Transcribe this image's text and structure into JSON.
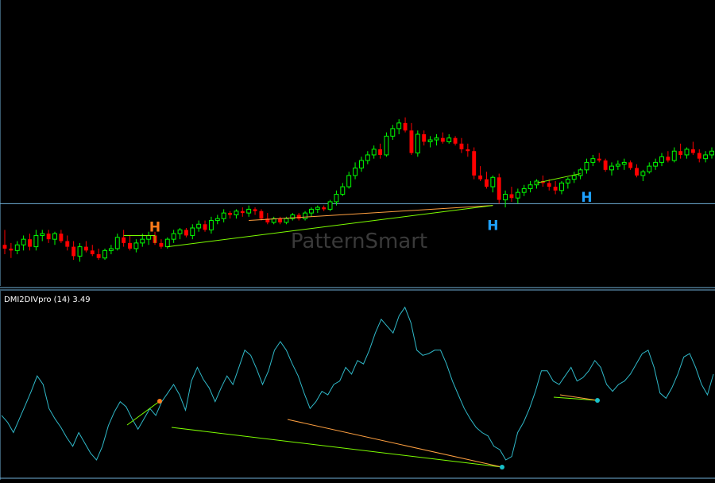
{
  "watermark": "PatternSmart",
  "indicator_label": "DMI2DIVpro (14) 3.49",
  "colors": {
    "background": "#000000",
    "bull_candle": "#00ff00",
    "bear_candle": "#ff0000",
    "indicator_line": "#2fb8c8",
    "border": "#6fb0d8",
    "level_line": "#6fb0d8",
    "div_green": "#7cfc00",
    "div_orange": "#ffa040",
    "marker_orange": "#ff7a1a",
    "marker_blue": "#1ea0ff",
    "marker_cyan": "#18c0c8",
    "watermark": "#3a3a3a"
  },
  "chart_data": [
    {
      "type": "candlestick",
      "price_range": [
        0,
        100
      ],
      "horizontal_level": 38,
      "candles": [
        {
          "o": 16,
          "h": 24,
          "l": 11,
          "c": 14
        },
        {
          "o": 14,
          "h": 17,
          "l": 9,
          "c": 13
        },
        {
          "o": 13,
          "h": 18,
          "l": 11,
          "c": 16
        },
        {
          "o": 16,
          "h": 21,
          "l": 13,
          "c": 19
        },
        {
          "o": 19,
          "h": 22,
          "l": 13,
          "c": 15
        },
        {
          "o": 15,
          "h": 24,
          "l": 13,
          "c": 21
        },
        {
          "o": 21,
          "h": 24,
          "l": 18,
          "c": 22
        },
        {
          "o": 22,
          "h": 24,
          "l": 17,
          "c": 19
        },
        {
          "o": 19,
          "h": 23,
          "l": 16,
          "c": 22
        },
        {
          "o": 22,
          "h": 24,
          "l": 17,
          "c": 18
        },
        {
          "o": 18,
          "h": 21,
          "l": 13,
          "c": 15
        },
        {
          "o": 15,
          "h": 18,
          "l": 8,
          "c": 10
        },
        {
          "o": 10,
          "h": 17,
          "l": 7,
          "c": 15
        },
        {
          "o": 15,
          "h": 18,
          "l": 12,
          "c": 13
        },
        {
          "o": 13,
          "h": 16,
          "l": 10,
          "c": 11
        },
        {
          "o": 11,
          "h": 14,
          "l": 8,
          "c": 9
        },
        {
          "o": 9,
          "h": 14,
          "l": 8,
          "c": 13
        },
        {
          "o": 13,
          "h": 16,
          "l": 11,
          "c": 14
        },
        {
          "o": 14,
          "h": 22,
          "l": 13,
          "c": 20
        },
        {
          "o": 20,
          "h": 24,
          "l": 15,
          "c": 17
        },
        {
          "o": 17,
          "h": 21,
          "l": 13,
          "c": 14
        },
        {
          "o": 14,
          "h": 19,
          "l": 12,
          "c": 17
        },
        {
          "o": 17,
          "h": 22,
          "l": 15,
          "c": 19
        },
        {
          "o": 19,
          "h": 23,
          "l": 16,
          "c": 21
        },
        {
          "o": 21,
          "h": 23,
          "l": 16,
          "c": 17
        },
        {
          "o": 17,
          "h": 19,
          "l": 14,
          "c": 15
        },
        {
          "o": 15,
          "h": 20,
          "l": 14,
          "c": 19
        },
        {
          "o": 19,
          "h": 24,
          "l": 17,
          "c": 22
        },
        {
          "o": 22,
          "h": 25,
          "l": 19,
          "c": 24
        },
        {
          "o": 24,
          "h": 25,
          "l": 20,
          "c": 21
        },
        {
          "o": 21,
          "h": 27,
          "l": 19,
          "c": 25
        },
        {
          "o": 25,
          "h": 29,
          "l": 23,
          "c": 27
        },
        {
          "o": 27,
          "h": 29,
          "l": 23,
          "c": 24
        },
        {
          "o": 24,
          "h": 31,
          "l": 22,
          "c": 29
        },
        {
          "o": 29,
          "h": 32,
          "l": 27,
          "c": 30
        },
        {
          "o": 30,
          "h": 35,
          "l": 28,
          "c": 33
        },
        {
          "o": 33,
          "h": 34,
          "l": 30,
          "c": 32
        },
        {
          "o": 32,
          "h": 35,
          "l": 30,
          "c": 34
        },
        {
          "o": 34,
          "h": 36,
          "l": 31,
          "c": 33
        },
        {
          "o": 33,
          "h": 37,
          "l": 31,
          "c": 35
        },
        {
          "o": 35,
          "h": 36,
          "l": 32,
          "c": 34
        },
        {
          "o": 34,
          "h": 35,
          "l": 29,
          "c": 30
        },
        {
          "o": 30,
          "h": 33,
          "l": 27,
          "c": 28
        },
        {
          "o": 28,
          "h": 31,
          "l": 27,
          "c": 30
        },
        {
          "o": 30,
          "h": 31,
          "l": 27,
          "c": 28
        },
        {
          "o": 28,
          "h": 31,
          "l": 27,
          "c": 30
        },
        {
          "o": 30,
          "h": 33,
          "l": 29,
          "c": 32
        },
        {
          "o": 32,
          "h": 33,
          "l": 29,
          "c": 30
        },
        {
          "o": 30,
          "h": 34,
          "l": 29,
          "c": 33
        },
        {
          "o": 33,
          "h": 36,
          "l": 31,
          "c": 35
        },
        {
          "o": 35,
          "h": 37,
          "l": 33,
          "c": 36
        },
        {
          "o": 36,
          "h": 37,
          "l": 34,
          "c": 35
        },
        {
          "o": 35,
          "h": 40,
          "l": 34,
          "c": 39
        },
        {
          "o": 39,
          "h": 45,
          "l": 37,
          "c": 43
        },
        {
          "o": 43,
          "h": 49,
          "l": 42,
          "c": 47
        },
        {
          "o": 47,
          "h": 55,
          "l": 46,
          "c": 53
        },
        {
          "o": 53,
          "h": 60,
          "l": 51,
          "c": 57
        },
        {
          "o": 57,
          "h": 63,
          "l": 55,
          "c": 61
        },
        {
          "o": 61,
          "h": 66,
          "l": 59,
          "c": 64
        },
        {
          "o": 64,
          "h": 69,
          "l": 62,
          "c": 67
        },
        {
          "o": 67,
          "h": 70,
          "l": 62,
          "c": 64
        },
        {
          "o": 64,
          "h": 76,
          "l": 63,
          "c": 74
        },
        {
          "o": 74,
          "h": 80,
          "l": 72,
          "c": 78
        },
        {
          "o": 78,
          "h": 83,
          "l": 75,
          "c": 81
        },
        {
          "o": 81,
          "h": 84,
          "l": 76,
          "c": 77
        },
        {
          "o": 77,
          "h": 81,
          "l": 64,
          "c": 65
        },
        {
          "o": 65,
          "h": 77,
          "l": 63,
          "c": 75
        },
        {
          "o": 75,
          "h": 77,
          "l": 69,
          "c": 71
        },
        {
          "o": 71,
          "h": 74,
          "l": 68,
          "c": 72
        },
        {
          "o": 72,
          "h": 75,
          "l": 69,
          "c": 73
        },
        {
          "o": 73,
          "h": 76,
          "l": 70,
          "c": 71
        },
        {
          "o": 71,
          "h": 75,
          "l": 70,
          "c": 73
        },
        {
          "o": 73,
          "h": 74,
          "l": 69,
          "c": 70
        },
        {
          "o": 70,
          "h": 73,
          "l": 65,
          "c": 67
        },
        {
          "o": 67,
          "h": 70,
          "l": 63,
          "c": 66
        },
        {
          "o": 66,
          "h": 68,
          "l": 51,
          "c": 53
        },
        {
          "o": 53,
          "h": 58,
          "l": 50,
          "c": 51
        },
        {
          "o": 51,
          "h": 55,
          "l": 46,
          "c": 47
        },
        {
          "o": 47,
          "h": 53,
          "l": 44,
          "c": 52
        },
        {
          "o": 52,
          "h": 54,
          "l": 38,
          "c": 40
        },
        {
          "o": 40,
          "h": 45,
          "l": 36,
          "c": 43
        },
        {
          "o": 43,
          "h": 47,
          "l": 39,
          "c": 41
        },
        {
          "o": 41,
          "h": 46,
          "l": 38,
          "c": 44
        },
        {
          "o": 44,
          "h": 48,
          "l": 42,
          "c": 46
        },
        {
          "o": 46,
          "h": 50,
          "l": 44,
          "c": 48
        },
        {
          "o": 48,
          "h": 51,
          "l": 46,
          "c": 50
        },
        {
          "o": 50,
          "h": 53,
          "l": 47,
          "c": 49
        },
        {
          "o": 49,
          "h": 51,
          "l": 45,
          "c": 47
        },
        {
          "o": 47,
          "h": 50,
          "l": 43,
          "c": 45
        },
        {
          "o": 45,
          "h": 50,
          "l": 43,
          "c": 49
        },
        {
          "o": 49,
          "h": 52,
          "l": 46,
          "c": 51
        },
        {
          "o": 51,
          "h": 55,
          "l": 49,
          "c": 53
        },
        {
          "o": 53,
          "h": 57,
          "l": 51,
          "c": 56
        },
        {
          "o": 56,
          "h": 62,
          "l": 54,
          "c": 60
        },
        {
          "o": 60,
          "h": 64,
          "l": 58,
          "c": 62
        },
        {
          "o": 62,
          "h": 65,
          "l": 60,
          "c": 61
        },
        {
          "o": 61,
          "h": 62,
          "l": 55,
          "c": 56
        },
        {
          "o": 56,
          "h": 60,
          "l": 53,
          "c": 58
        },
        {
          "o": 58,
          "h": 61,
          "l": 56,
          "c": 59
        },
        {
          "o": 59,
          "h": 62,
          "l": 56,
          "c": 60
        },
        {
          "o": 60,
          "h": 61,
          "l": 56,
          "c": 57
        },
        {
          "o": 57,
          "h": 59,
          "l": 52,
          "c": 53
        },
        {
          "o": 53,
          "h": 56,
          "l": 50,
          "c": 55
        },
        {
          "o": 55,
          "h": 60,
          "l": 54,
          "c": 58
        },
        {
          "o": 58,
          "h": 62,
          "l": 56,
          "c": 60
        },
        {
          "o": 60,
          "h": 65,
          "l": 58,
          "c": 63
        },
        {
          "o": 63,
          "h": 66,
          "l": 60,
          "c": 61
        },
        {
          "o": 61,
          "h": 68,
          "l": 60,
          "c": 66
        },
        {
          "o": 66,
          "h": 70,
          "l": 62,
          "c": 64
        },
        {
          "o": 64,
          "h": 68,
          "l": 62,
          "c": 67
        },
        {
          "o": 67,
          "h": 71,
          "l": 64,
          "c": 65
        },
        {
          "o": 65,
          "h": 67,
          "l": 60,
          "c": 62
        },
        {
          "o": 62,
          "h": 66,
          "l": 60,
          "c": 64
        },
        {
          "o": 64,
          "h": 68,
          "l": 62,
          "c": 66
        }
      ],
      "divergence_lines": [
        {
          "from": [
            39,
            29
          ],
          "to": [
            78,
            37
          ],
          "color": "div_orange"
        },
        {
          "from": [
            26,
            15
          ],
          "to": [
            78,
            37
          ],
          "color": "div_green"
        },
        {
          "from": [
            19,
            21
          ],
          "to": [
            24,
            21
          ],
          "color": "div_green"
        },
        {
          "from": [
            85,
            49
          ],
          "to": [
            92,
            54
          ],
          "color": "div_green"
        },
        {
          "from": [
            24,
            17
          ],
          "to": [
            24,
            21
          ],
          "color": "div_green"
        }
      ],
      "labels": [
        {
          "text": "H",
          "x": 24,
          "y": 23,
          "color": "marker_orange"
        },
        {
          "text": "H",
          "x": 78,
          "y": 24,
          "color": "marker_blue"
        },
        {
          "text": "H",
          "x": 93,
          "y": 39,
          "color": "marker_blue"
        }
      ]
    },
    {
      "type": "line",
      "name": "DMI2DIVpro (14) 3.49",
      "y_range": [
        0,
        100
      ],
      "values": [
        32,
        28,
        22,
        30,
        38,
        46,
        55,
        50,
        36,
        30,
        25,
        19,
        14,
        22,
        16,
        10,
        6,
        14,
        26,
        34,
        40,
        37,
        30,
        24,
        30,
        36,
        32,
        40,
        45,
        50,
        44,
        35,
        52,
        60,
        53,
        48,
        40,
        48,
        55,
        50,
        60,
        70,
        67,
        59,
        50,
        58,
        70,
        75,
        70,
        62,
        55,
        45,
        36,
        40,
        46,
        44,
        50,
        52,
        60,
        56,
        64,
        62,
        70,
        80,
        88,
        84,
        80,
        90,
        95,
        86,
        70,
        67,
        68,
        70,
        70,
        62,
        52,
        44,
        36,
        30,
        25,
        22,
        20,
        14,
        12,
        6,
        8,
        22,
        28,
        36,
        46,
        58,
        58,
        52,
        50,
        55,
        60,
        52,
        54,
        58,
        64,
        60,
        50,
        46,
        50,
        52,
        56,
        62,
        68,
        70,
        60,
        45,
        42,
        48,
        56,
        66,
        68,
        60,
        50,
        44,
        56
      ]
    }
  ]
}
